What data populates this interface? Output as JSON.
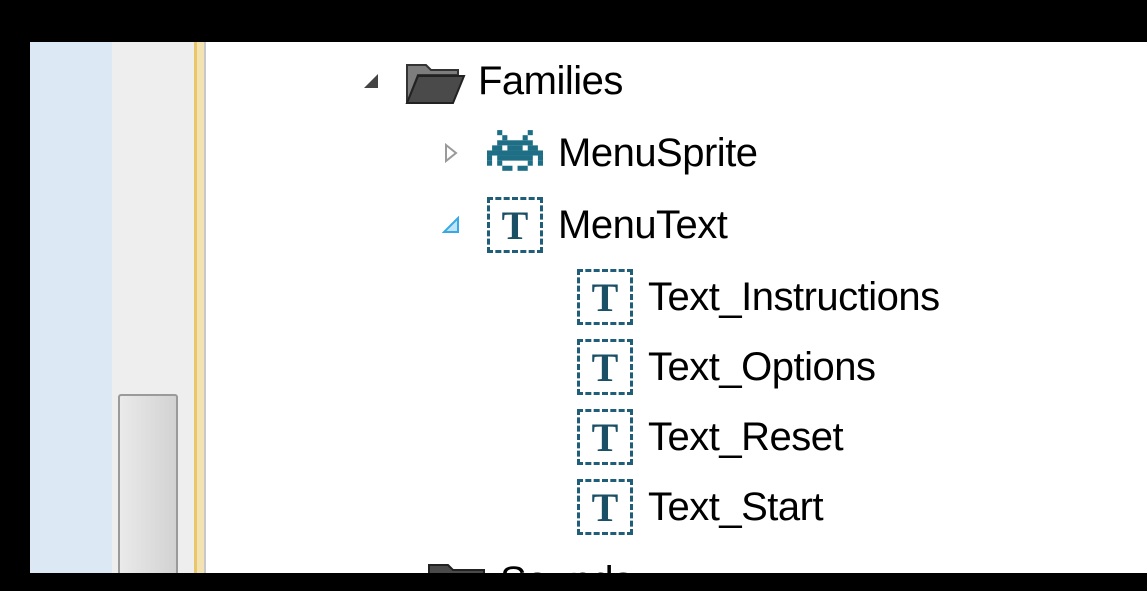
{
  "tree": {
    "families": {
      "label": "Families",
      "icon": "folder-open-icon",
      "expanded": true
    },
    "menu_sprite": {
      "label": "MenuSprite",
      "icon": "sprite-invader-icon",
      "expanded": false
    },
    "menu_text": {
      "label": "MenuText",
      "icon": "text-object-icon",
      "icon_glyph": "T",
      "expanded": true,
      "children": [
        {
          "label": "Text_Instructions",
          "icon": "text-object-icon",
          "icon_glyph": "T"
        },
        {
          "label": "Text_Options",
          "icon": "text-object-icon",
          "icon_glyph": "T"
        },
        {
          "label": "Text_Reset",
          "icon": "text-object-icon",
          "icon_glyph": "T"
        },
        {
          "label": "Text_Start",
          "icon": "text-object-icon",
          "icon_glyph": "T"
        }
      ]
    },
    "next_folder": {
      "label": "Sounds",
      "icon": "folder-icon"
    }
  },
  "colors": {
    "text_icon_border": "#1f5d78",
    "sprite_icon": "#1e6f86",
    "selected_arrow": "#38a9e6"
  }
}
